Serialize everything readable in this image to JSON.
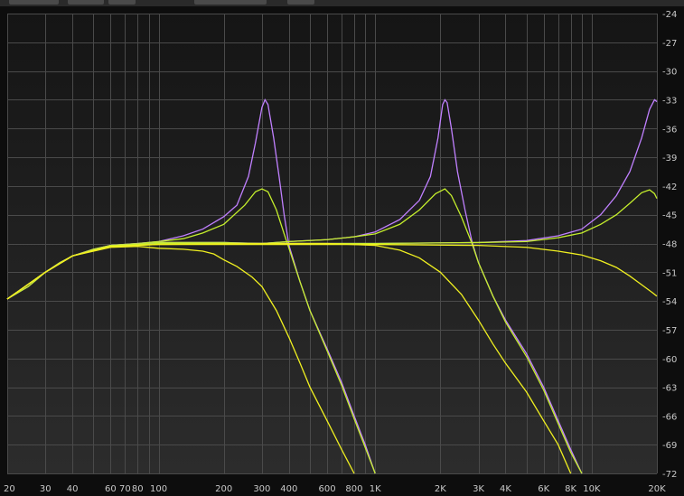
{
  "chart_data": {
    "type": "line",
    "x_scale": "log",
    "xlim": [
      20,
      20000
    ],
    "ylim": [
      -72,
      -24
    ],
    "grid": true,
    "x_ticks": [
      {
        "value": 20,
        "label": "20"
      },
      {
        "value": 30,
        "label": "30"
      },
      {
        "value": 40,
        "label": "40"
      },
      {
        "value": 60,
        "label": "60"
      },
      {
        "value": 70,
        "label": "70"
      },
      {
        "value": 80,
        "label": "80"
      },
      {
        "value": 100,
        "label": "100"
      },
      {
        "value": 200,
        "label": "200"
      },
      {
        "value": 300,
        "label": "300"
      },
      {
        "value": 400,
        "label": "400"
      },
      {
        "value": 600,
        "label": "600"
      },
      {
        "value": 800,
        "label": "800"
      },
      {
        "value": 1000,
        "label": "1K"
      },
      {
        "value": 2000,
        "label": "2K"
      },
      {
        "value": 3000,
        "label": "3K"
      },
      {
        "value": 4000,
        "label": "4K"
      },
      {
        "value": 6000,
        "label": "6K"
      },
      {
        "value": 8000,
        "label": "8K"
      },
      {
        "value": 10000,
        "label": "10K"
      },
      {
        "value": 20000,
        "label": "20K"
      }
    ],
    "y_ticks": [
      -24,
      -27,
      -30,
      -33,
      -36,
      -39,
      -42,
      -45,
      -48,
      -51,
      -54,
      -57,
      -60,
      -63,
      -66,
      -69,
      -72
    ],
    "series": [
      {
        "color": "#c080ff",
        "points": [
          [
            20,
            -53.8
          ],
          [
            25,
            -52.5
          ],
          [
            30,
            -51
          ],
          [
            35,
            -50
          ],
          [
            40,
            -49.3
          ],
          [
            50,
            -48.6
          ],
          [
            60,
            -48.2
          ],
          [
            80,
            -48
          ],
          [
            100,
            -47.8
          ],
          [
            130,
            -47.2
          ],
          [
            160,
            -46.5
          ],
          [
            200,
            -45.2
          ],
          [
            230,
            -44
          ],
          [
            260,
            -41
          ],
          [
            280,
            -37.5
          ],
          [
            300,
            -33.8
          ],
          [
            310,
            -33
          ],
          [
            320,
            -33.5
          ],
          [
            340,
            -37
          ],
          [
            360,
            -41
          ],
          [
            380,
            -45
          ],
          [
            400,
            -48.2
          ],
          [
            450,
            -52
          ],
          [
            500,
            -55
          ],
          [
            600,
            -59
          ],
          [
            700,
            -62.5
          ],
          [
            800,
            -66
          ],
          [
            900,
            -69
          ],
          [
            1000,
            -72
          ]
        ]
      },
      {
        "color": "#c5ef2c",
        "points": [
          [
            20,
            -53.8
          ],
          [
            25,
            -52.5
          ],
          [
            30,
            -51
          ],
          [
            35,
            -50
          ],
          [
            40,
            -49.3
          ],
          [
            50,
            -48.6
          ],
          [
            60,
            -48.2
          ],
          [
            80,
            -48
          ],
          [
            100,
            -47.8
          ],
          [
            130,
            -47.5
          ],
          [
            160,
            -46.9
          ],
          [
            200,
            -46
          ],
          [
            250,
            -44
          ],
          [
            280,
            -42.6
          ],
          [
            300,
            -42.3
          ],
          [
            320,
            -42.6
          ],
          [
            350,
            -44.5
          ],
          [
            380,
            -47
          ],
          [
            400,
            -48.5
          ],
          [
            450,
            -52
          ],
          [
            500,
            -55
          ],
          [
            600,
            -59.2
          ],
          [
            700,
            -62.8
          ],
          [
            800,
            -66.3
          ],
          [
            900,
            -69.3
          ],
          [
            1000,
            -72
          ]
        ]
      },
      {
        "color": "#c080ff",
        "points": [
          [
            20,
            -53.8
          ],
          [
            30,
            -51
          ],
          [
            40,
            -49.3
          ],
          [
            60,
            -48.2
          ],
          [
            100,
            -47.9
          ],
          [
            200,
            -47.9
          ],
          [
            300,
            -48
          ],
          [
            400,
            -47.8
          ],
          [
            600,
            -47.6
          ],
          [
            800,
            -47.3
          ],
          [
            1000,
            -46.8
          ],
          [
            1300,
            -45.5
          ],
          [
            1600,
            -43.5
          ],
          [
            1800,
            -41
          ],
          [
            1950,
            -37
          ],
          [
            2050,
            -33.5
          ],
          [
            2100,
            -33
          ],
          [
            2150,
            -33.3
          ],
          [
            2250,
            -36
          ],
          [
            2400,
            -40.5
          ],
          [
            2600,
            -44.5
          ],
          [
            2800,
            -47.8
          ],
          [
            3000,
            -50
          ],
          [
            3500,
            -53.5
          ],
          [
            4000,
            -56
          ],
          [
            5000,
            -59.5
          ],
          [
            6000,
            -63
          ],
          [
            7000,
            -66.5
          ],
          [
            8000,
            -69.5
          ],
          [
            9000,
            -72
          ]
        ]
      },
      {
        "color": "#c5ef2c",
        "points": [
          [
            20,
            -53.8
          ],
          [
            30,
            -51
          ],
          [
            40,
            -49.3
          ],
          [
            60,
            -48.2
          ],
          [
            100,
            -47.9
          ],
          [
            200,
            -47.9
          ],
          [
            300,
            -48
          ],
          [
            400,
            -47.8
          ],
          [
            600,
            -47.6
          ],
          [
            800,
            -47.3
          ],
          [
            1000,
            -47
          ],
          [
            1300,
            -46
          ],
          [
            1600,
            -44.5
          ],
          [
            1900,
            -42.8
          ],
          [
            2100,
            -42.3
          ],
          [
            2250,
            -43
          ],
          [
            2500,
            -45.2
          ],
          [
            2800,
            -48
          ],
          [
            3000,
            -50
          ],
          [
            3500,
            -53.5
          ],
          [
            4000,
            -56.2
          ],
          [
            5000,
            -59.8
          ],
          [
            6000,
            -63.3
          ],
          [
            7000,
            -66.8
          ],
          [
            8000,
            -69.8
          ],
          [
            9000,
            -72
          ]
        ]
      },
      {
        "color": "#c080ff",
        "points": [
          [
            20,
            -53.8
          ],
          [
            30,
            -51
          ],
          [
            40,
            -49.3
          ],
          [
            60,
            -48.2
          ],
          [
            100,
            -48
          ],
          [
            300,
            -48
          ],
          [
            1000,
            -48
          ],
          [
            3000,
            -47.9
          ],
          [
            5000,
            -47.7
          ],
          [
            7000,
            -47.2
          ],
          [
            9000,
            -46.5
          ],
          [
            11000,
            -45
          ],
          [
            13000,
            -43
          ],
          [
            15000,
            -40.5
          ],
          [
            17000,
            -37
          ],
          [
            18500,
            -34
          ],
          [
            19500,
            -33
          ],
          [
            20000,
            -33.2
          ]
        ]
      },
      {
        "color": "#c5ef2c",
        "points": [
          [
            20,
            -53.8
          ],
          [
            30,
            -51
          ],
          [
            40,
            -49.3
          ],
          [
            60,
            -48.2
          ],
          [
            100,
            -48
          ],
          [
            300,
            -48
          ],
          [
            1000,
            -48
          ],
          [
            3000,
            -47.9
          ],
          [
            5000,
            -47.8
          ],
          [
            7000,
            -47.4
          ],
          [
            9000,
            -46.9
          ],
          [
            11000,
            -46
          ],
          [
            13000,
            -45
          ],
          [
            15000,
            -43.8
          ],
          [
            17000,
            -42.7
          ],
          [
            18500,
            -42.4
          ],
          [
            19500,
            -42.8
          ],
          [
            20000,
            -43.3
          ]
        ]
      },
      {
        "color": "#f0f020",
        "points": [
          [
            20,
            -53.8
          ],
          [
            30,
            -51
          ],
          [
            40,
            -49.3
          ],
          [
            60,
            -48.4
          ],
          [
            80,
            -48.3
          ],
          [
            100,
            -48.5
          ],
          [
            130,
            -48.6
          ],
          [
            160,
            -48.8
          ],
          [
            180,
            -49.1
          ],
          [
            200,
            -49.7
          ],
          [
            230,
            -50.4
          ],
          [
            270,
            -51.5
          ],
          [
            300,
            -52.5
          ],
          [
            350,
            -55
          ],
          [
            400,
            -57.8
          ],
          [
            450,
            -60.5
          ],
          [
            500,
            -63
          ],
          [
            600,
            -66.5
          ],
          [
            700,
            -69.5
          ],
          [
            800,
            -72
          ]
        ]
      },
      {
        "color": "#f0f020",
        "points": [
          [
            20,
            -53.8
          ],
          [
            30,
            -51
          ],
          [
            40,
            -49.3
          ],
          [
            60,
            -48.3
          ],
          [
            100,
            -48.1
          ],
          [
            300,
            -48
          ],
          [
            600,
            -48
          ],
          [
            1000,
            -48.2
          ],
          [
            1300,
            -48.7
          ],
          [
            1600,
            -49.5
          ],
          [
            2000,
            -51
          ],
          [
            2500,
            -53.3
          ],
          [
            3000,
            -56
          ],
          [
            3500,
            -58.5
          ],
          [
            4000,
            -60.5
          ],
          [
            5000,
            -63.5
          ],
          [
            6000,
            -66.5
          ],
          [
            7000,
            -69
          ],
          [
            8000,
            -72
          ]
        ]
      },
      {
        "color": "#f0f020",
        "points": [
          [
            20,
            -53.8
          ],
          [
            30,
            -51
          ],
          [
            40,
            -49.3
          ],
          [
            60,
            -48.3
          ],
          [
            100,
            -48.1
          ],
          [
            300,
            -48.1
          ],
          [
            1000,
            -48.1
          ],
          [
            3000,
            -48.2
          ],
          [
            5000,
            -48.4
          ],
          [
            7000,
            -48.8
          ],
          [
            9000,
            -49.2
          ],
          [
            11000,
            -49.8
          ],
          [
            13000,
            -50.5
          ],
          [
            15000,
            -51.4
          ],
          [
            17000,
            -52.3
          ],
          [
            19000,
            -53.1
          ],
          [
            20000,
            -53.5
          ]
        ]
      }
    ]
  }
}
